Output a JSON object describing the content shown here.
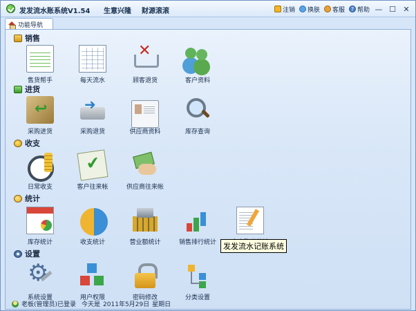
{
  "window": {
    "title": "发发流水账系统V1.54",
    "slogans": [
      "生意兴隆",
      "财源滚滚"
    ],
    "actions": [
      {
        "label": "注销",
        "icon": "lock-icon"
      },
      {
        "label": "换肤",
        "icon": "skin-icon"
      },
      {
        "label": "客服",
        "icon": "service-icon"
      },
      {
        "label": "帮助",
        "icon": "help-icon"
      }
    ],
    "controls": {
      "minimize": "—",
      "maximize": "☐",
      "close": "✕"
    }
  },
  "tabs": [
    {
      "label": "功能导航",
      "active": true
    }
  ],
  "sections": [
    {
      "title": "销售",
      "items": [
        "售货帮手",
        "每天流水",
        "顾客退货",
        "客户资料"
      ]
    },
    {
      "title": "进货",
      "items": [
        "采购进货",
        "采购退货",
        "供应商资料",
        "库存查询"
      ]
    },
    {
      "title": "收支",
      "items": [
        "日常收支",
        "客户往来帐",
        "供应商往来帐"
      ]
    },
    {
      "title": "统计",
      "items": [
        "库存统计",
        "收支统计",
        "营业额统计",
        "销售排行统计",
        "客户购买统计"
      ]
    },
    {
      "title": "设置",
      "items": [
        "系统设置",
        "用户权限",
        "密码修改",
        "分类设置"
      ]
    }
  ],
  "tooltip": "发发流水记账系统",
  "status": {
    "user": "老板(管理员)已登录",
    "today_label": "今天是",
    "date": "2011年5月29日",
    "weekday": "星期日"
  },
  "colors": {
    "accent": "#2b8a1c",
    "panel_bg": "#d6e6f8"
  }
}
